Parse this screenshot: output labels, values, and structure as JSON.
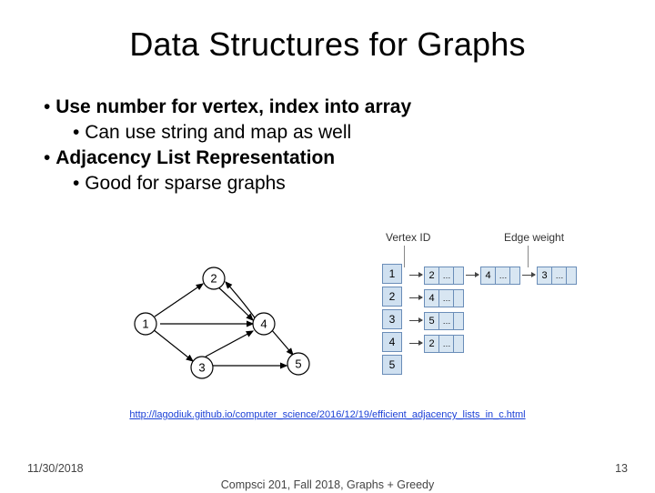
{
  "title": "Data Structures for Graphs",
  "bullets": {
    "l1a": "Use number for vertex, index into array",
    "l2a": "Can use string and map as well",
    "l1b": "Adjacency List Representation",
    "l2b": "Good for sparse graphs"
  },
  "labels": {
    "vertex_id": "Vertex ID",
    "edge_weight": "Edge weight"
  },
  "graph": {
    "vertices": [
      "1",
      "2",
      "3",
      "4",
      "5"
    ],
    "adjacency": [
      {
        "v": "1",
        "edges": [
          [
            "2",
            "…"
          ],
          [
            "4",
            "…"
          ],
          [
            "3",
            "…"
          ]
        ]
      },
      {
        "v": "2",
        "edges": [
          [
            "4",
            "…"
          ]
        ]
      },
      {
        "v": "3",
        "edges": [
          [
            "5",
            "…"
          ]
        ]
      },
      {
        "v": "4",
        "edges": [
          [
            "2",
            "…"
          ]
        ]
      },
      {
        "v": "5",
        "edges": []
      }
    ]
  },
  "source": {
    "text": "http://lagodiuk.github.io/computer_science/2016/12/19/efficient_adjacency_lists_in_c.html",
    "href": "http://lagodiuk.github.io/computer_science/2016/12/19/efficient_adjacency_lists_in_c.html"
  },
  "footer": {
    "date": "11/30/2018",
    "course": "Compsci 201, Fall 2018,  Graphs + Greedy",
    "page": "13"
  }
}
